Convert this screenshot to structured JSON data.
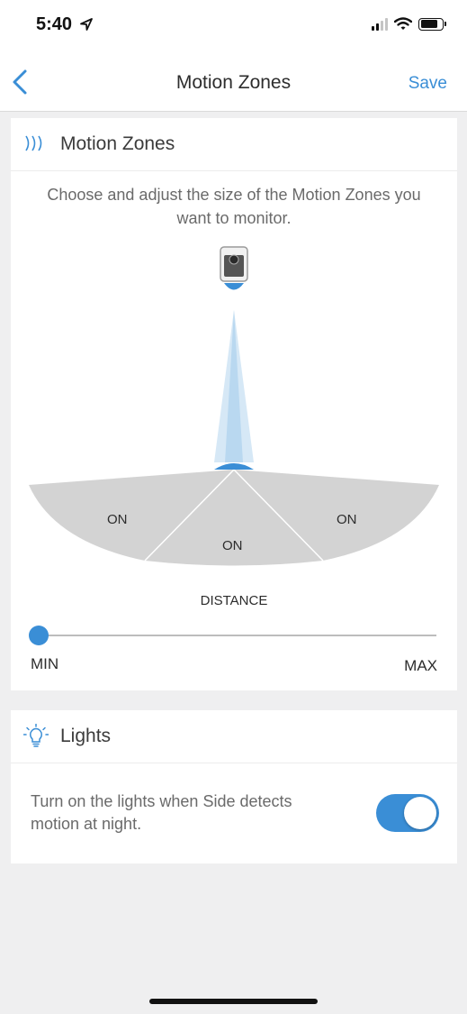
{
  "status_bar": {
    "time": "5:40"
  },
  "nav": {
    "title": "Motion Zones",
    "save_label": "Save"
  },
  "motion_card": {
    "title": "Motion Zones",
    "description": "Choose and adjust the size of the Motion Zones you want to monitor.",
    "zones": {
      "left": "ON",
      "center": "ON",
      "right": "ON"
    },
    "distance_label": "DISTANCE",
    "slider": {
      "min_label": "MIN",
      "max_label": "MAX",
      "value": 0
    }
  },
  "lights_card": {
    "title": "Lights",
    "description": "Turn on the lights when Side detects motion at night.",
    "toggle_on": true
  },
  "colors": {
    "accent": "#3a8ed6",
    "zone_fill": "#d3d3d3",
    "background": "#efeff0"
  }
}
